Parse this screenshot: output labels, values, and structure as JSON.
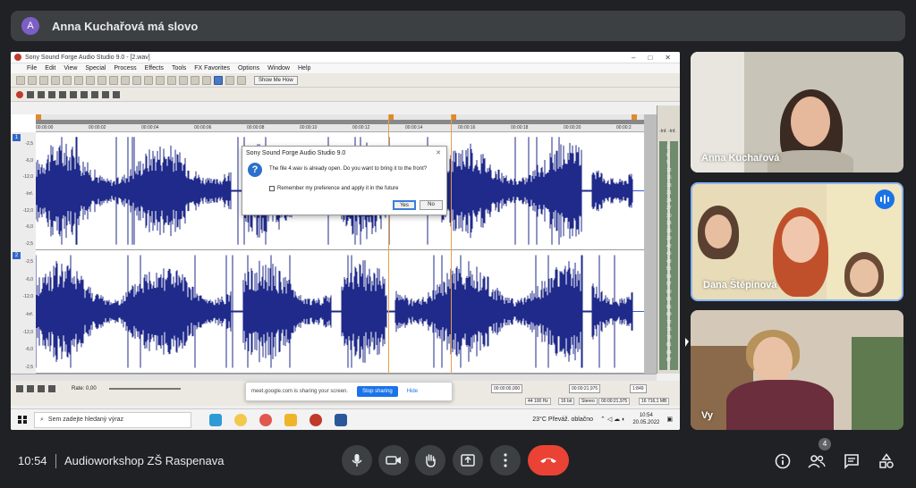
{
  "speaker_bar": {
    "avatar_letter": "A",
    "text": "Anna Kuchařová má slovo"
  },
  "shared_screen": {
    "window_title": "Sony Sound Forge Audio Studio 9.0 - [2.wav]",
    "menu": [
      "File",
      "Edit",
      "View",
      "Special",
      "Process",
      "Effects",
      "Tools",
      "FX Favorites",
      "Options",
      "Window",
      "Help"
    ],
    "show_me_how": "Show Me How",
    "ruler_ticks": [
      "00:00:00",
      "00:00:02",
      "00:00:04",
      "00:00:06",
      "00:00:08",
      "00:00:10",
      "00:00:12",
      "00:00:14",
      "00:00:16",
      "00:00:18",
      "00:00:20",
      "00:00:2"
    ],
    "db_labels": [
      "-2,5",
      "-6,0",
      "-12,0",
      "-Inf.",
      "-12,0",
      "-6,0",
      "-2,5"
    ],
    "channels": [
      "1",
      "2"
    ],
    "meter_values": [
      "3",
      "6",
      "9",
      "12",
      "15",
      "18",
      "21",
      "24",
      "27",
      "30",
      "33",
      "36",
      "39",
      "42",
      "45",
      "48",
      "51",
      "54",
      "57",
      "60",
      "63",
      "66",
      "69",
      "72",
      "75",
      "78",
      "81",
      "84",
      "87"
    ],
    "meter_header": "-Inf. -Inf.",
    "rate_label": "Rate: 0,00",
    "time_start": "00:00:00,000",
    "time_end": "00:00:21,975",
    "zoom": "1:849",
    "status": [
      "44 100 Hz",
      "16 bit",
      "Stereo",
      "00:00:21,975",
      "16 716,1 MB"
    ],
    "dialog": {
      "title": "Sony Sound Forge Audio Studio 9.0",
      "message": "The file 4.wav is already open. Do you want to bring it to the front?",
      "checkbox": "Remember my preference and apply it in the future",
      "yes": "Yes",
      "no": "No"
    },
    "sharing_notice": {
      "text": "meet.google.com is sharing your screen.",
      "stop": "Stop sharing",
      "hide": "Hide"
    },
    "taskbar": {
      "search": "Sem zadejte hledaný výraz",
      "weather": "23°C  Převáž. oblačno",
      "time": "10:54",
      "date": "20.05.2022"
    }
  },
  "participants": [
    {
      "name": "Anna Kuchařová"
    },
    {
      "name": "Dana Štěpinová",
      "speaking": true
    },
    {
      "name": "Vy"
    }
  ],
  "bottom_bar": {
    "time": "10:54",
    "meeting": "Audioworkshop ZŠ Raspenava",
    "people_count": "4",
    "colors": {
      "end_call": "#ea4335",
      "control_bg": "#3c4043",
      "accent": "#1a73e8"
    }
  }
}
